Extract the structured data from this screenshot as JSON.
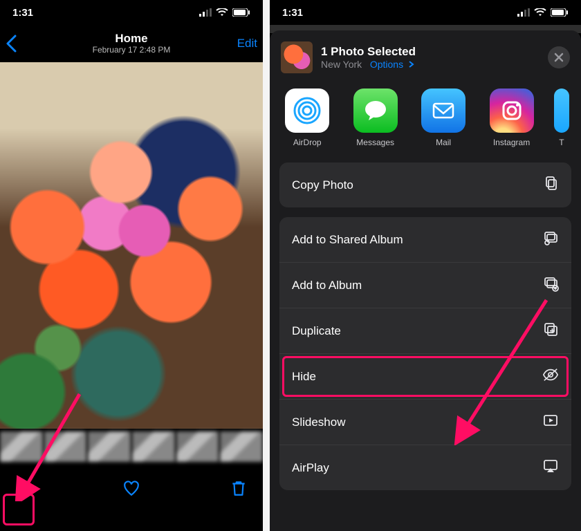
{
  "status": {
    "time": "1:31"
  },
  "left": {
    "nav": {
      "title": "Home",
      "subtitle": "February 17  2:48 PM",
      "edit": "Edit"
    }
  },
  "right": {
    "header": {
      "title": "1 Photo Selected",
      "location": "New York",
      "options_label": "Options"
    },
    "apps": [
      {
        "label": "AirDrop"
      },
      {
        "label": "Messages"
      },
      {
        "label": "Mail"
      },
      {
        "label": "Instagram"
      }
    ],
    "copy_row": "Copy Photo",
    "actions": [
      "Add to Shared Album",
      "Add to Album",
      "Duplicate",
      "Hide",
      "Slideshow",
      "AirPlay"
    ]
  }
}
